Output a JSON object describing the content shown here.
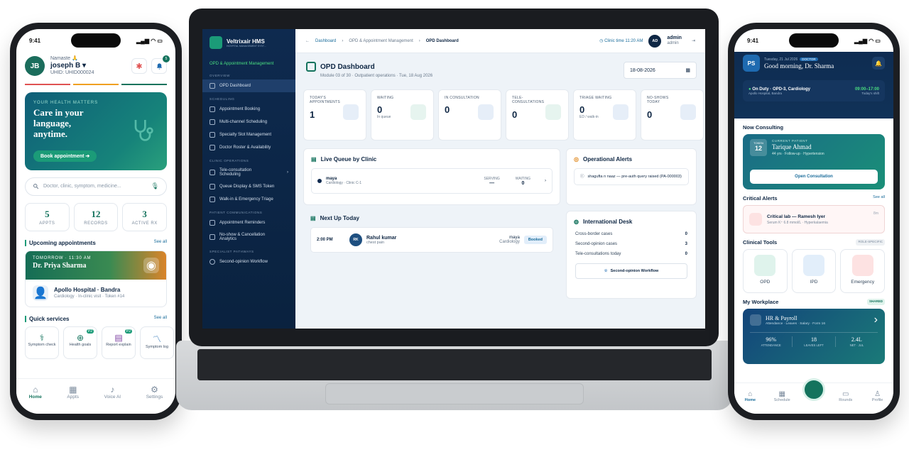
{
  "left_phone": {
    "time": "9:41",
    "avatar": "JB",
    "greeting": "Namaste 🙏",
    "name": "joseph B",
    "uhid": "UHID: UHID000024",
    "notif_count": "5",
    "hero": {
      "kicker": "YOUR HEALTH MATTERS",
      "title": "Care in your language, anytime.",
      "button": "Book appointment"
    },
    "search_placeholder": "Doctor, clinic, symptom, medicine...",
    "stats": [
      {
        "value": "5",
        "label": "APPTS"
      },
      {
        "value": "12",
        "label": "RECORDS"
      },
      {
        "value": "3",
        "label": "ACTIVE RX"
      }
    ],
    "upcoming": {
      "title": "Upcoming appointments",
      "see_all": "See all",
      "when": "TOMORROW · 11:30 AM",
      "doctor": "Dr. Priya Sharma",
      "place": "Apollo Hospital · Bandra",
      "detail": "Cardiology · In-clinic visit · Token #14"
    },
    "quick": {
      "title": "Quick services",
      "see_all": "See all",
      "items": [
        {
          "label": "Symptom check",
          "badge": ""
        },
        {
          "label": "Health goals",
          "badge": "P2"
        },
        {
          "label": "Report explain",
          "badge": "P2"
        },
        {
          "label": "Symptom log",
          "badge": ""
        }
      ]
    },
    "tabs": [
      "Home",
      "Appts",
      "Voice AI",
      "Settings"
    ]
  },
  "laptop": {
    "brand": "Veltrixair HMS",
    "brand_sub": "HOSPITAL MANAGEMENT SYST...",
    "module": "OPD & Appointment Management",
    "nav": [
      {
        "group": "OVERVIEW",
        "items": [
          "OPD Dashboard"
        ]
      },
      {
        "group": "SCHEDULING",
        "items": [
          "Appointment Booking",
          "Multi-channel Scheduling",
          "Specialty Slot Management",
          "Doctor Roster & Availability"
        ]
      },
      {
        "group": "CLINIC OPERATIONS",
        "items": [
          "Tele-consultation Scheduling",
          "Queue Display & SMS Token",
          "Walk-in & Emergency Triage"
        ]
      },
      {
        "group": "PATIENT COMMUNICATIONS",
        "items": [
          "Appointment Reminders",
          "No-show & Cancellation Analytics"
        ]
      },
      {
        "group": "SPECIALIST PATHWAYS",
        "items": [
          "Second-opinion Workflow"
        ]
      }
    ],
    "breadcrumb": [
      "Dashboard",
      "OPD & Appointment Management",
      "OPD Dashboard"
    ],
    "clinic_time": "Clinic time 11:20 AM",
    "user_initials": "AD",
    "user_name": "admin",
    "user_role": "admin",
    "title": "OPD Dashboard",
    "subtitle": "Module 03 of 30 · Outpatient operations · Tue, 18 Aug 2026",
    "date": "18-08-2026",
    "kpis": [
      {
        "label": "TODAY'S APPOINTMENTS",
        "value": "1",
        "hint": ""
      },
      {
        "label": "WAITING",
        "value": "0",
        "hint": "In queue"
      },
      {
        "label": "IN CONSULTATION",
        "value": "0",
        "hint": ""
      },
      {
        "label": "TELE-CONSULTATIONS",
        "value": "0",
        "hint": ""
      },
      {
        "label": "TRIAGE WAITING",
        "value": "0",
        "hint": "ED / walk-in"
      },
      {
        "label": "NO-SHOWS TODAY",
        "value": "0",
        "hint": ""
      }
    ],
    "live_queue": {
      "title": "Live Queue by Clinic",
      "name": "maya",
      "clinic": "Cardiology · Clinic C-1",
      "serving_label": "SERVING",
      "serving": "—",
      "waiting_label": "WAITING",
      "waiting": "0"
    },
    "next_up": {
      "title": "Next Up Today",
      "time": "2:00 PM",
      "initials": "RK",
      "name": "Rahul kumar",
      "complaint": "chest pain",
      "doctor": "maya",
      "dept": "Cardiology",
      "status": "Booked"
    },
    "alerts": {
      "title": "Operational Alerts",
      "text": "shagufta n naaz — pre-auth query raised (PA-000003)"
    },
    "intl": {
      "title": "International Desk",
      "rows": [
        {
          "label": "Cross-border cases",
          "value": "0"
        },
        {
          "label": "Second-opinion cases",
          "value": "3"
        },
        {
          "label": "Tele-consultations today",
          "value": "0"
        }
      ],
      "button": "Second-opinion Workflow"
    }
  },
  "right_phone": {
    "time": "9:41",
    "initials": "PS",
    "date": "Tuesday, 21 Jul 2026",
    "role": "DOCTOR",
    "greeting": "Good morning, Dr. Sharma",
    "duty": {
      "title": "On Duty · OPD-3, Cardiology",
      "place": "Apollo Hospital, Bandra",
      "shift": "09:00–17:00",
      "shift_label": "Today's shift"
    },
    "now": {
      "title": "Now Consulting",
      "token_label": "TOKEN",
      "token": "12",
      "kicker": "CURRENT PATIENT",
      "name": "Tarique Ahmad",
      "detail": "44 yrs · Follow-up · Hypertension",
      "button": "Open Consultation"
    },
    "critical": {
      "title": "Critical Alerts",
      "see_all": "See all",
      "head": "Critical lab — Ramesh Iyer",
      "detail": "Serum K⁺ 6.8 mmol/L · Hyperkalaemia",
      "ago": "8m"
    },
    "tools": {
      "title": "Clinical Tools",
      "tag": "ROLE-SPECIFIC",
      "items": [
        "OPD",
        "IPD",
        "Emergency"
      ]
    },
    "workplace": {
      "title": "My Workplace",
      "tag": "SHARED",
      "card_title": "HR & Payroll",
      "card_sub": "Attendance · Leaves · Salary · Form 16",
      "metrics": [
        {
          "value": "96%",
          "label": "ATTENDANCE"
        },
        {
          "value": "18",
          "label": "LEAVES LEFT"
        },
        {
          "value": "2.4L",
          "label": "NET · JUL"
        }
      ]
    },
    "tabs": [
      "Home",
      "Schedule",
      "",
      "Rounds",
      "Profile"
    ]
  },
  "colors": {
    "accent": "#14735d",
    "navy": "#0e2a4f",
    "link": "#1b6d9b",
    "alert_red": "#e05252"
  }
}
